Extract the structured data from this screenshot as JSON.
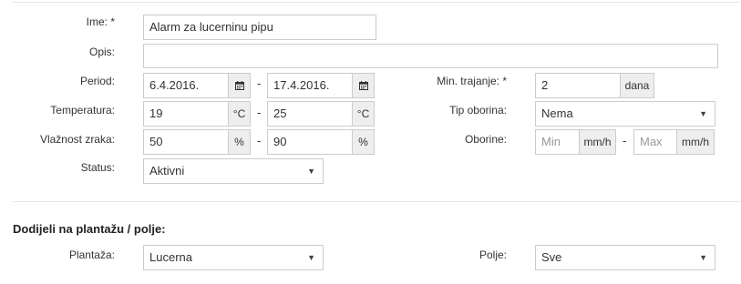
{
  "form": {
    "name": {
      "label": "Ime: *",
      "value": "Alarm za lucerninu pipu"
    },
    "description": {
      "label": "Opis:",
      "value": ""
    },
    "period": {
      "label": "Period:",
      "from": "6.4.2016.",
      "to": "17.4.2016.",
      "separator": "-"
    },
    "temperature": {
      "label": "Temperatura:",
      "from": "19",
      "to": "25",
      "unit": "°C",
      "separator": "-"
    },
    "humidity": {
      "label": "Vlažnost zraka:",
      "from": "50",
      "to": "90",
      "unit": "%",
      "separator": "-"
    },
    "status": {
      "label": "Status:",
      "value": "Aktivni"
    },
    "min_duration": {
      "label": "Min. trajanje: *",
      "value": "2",
      "unit": "dana"
    },
    "precip_type": {
      "label": "Tip oborina:",
      "value": "Nema"
    },
    "precip": {
      "label": "Oborine:",
      "min_placeholder": "Min",
      "max_placeholder": "Max",
      "unit": "mm/h",
      "separator": "-"
    }
  },
  "assign": {
    "title": "Dodijeli na plantažu / polje:",
    "plantation": {
      "label": "Plantaža:",
      "value": "Lucerna"
    },
    "field": {
      "label": "Polje:",
      "value": "Sve"
    }
  },
  "icons": {
    "calendar": "calendar-icon",
    "caret": "caret-down-icon"
  },
  "colors": {
    "border": "#cccccc",
    "addon_bg": "#eeeeee",
    "placeholder": "#999999"
  }
}
